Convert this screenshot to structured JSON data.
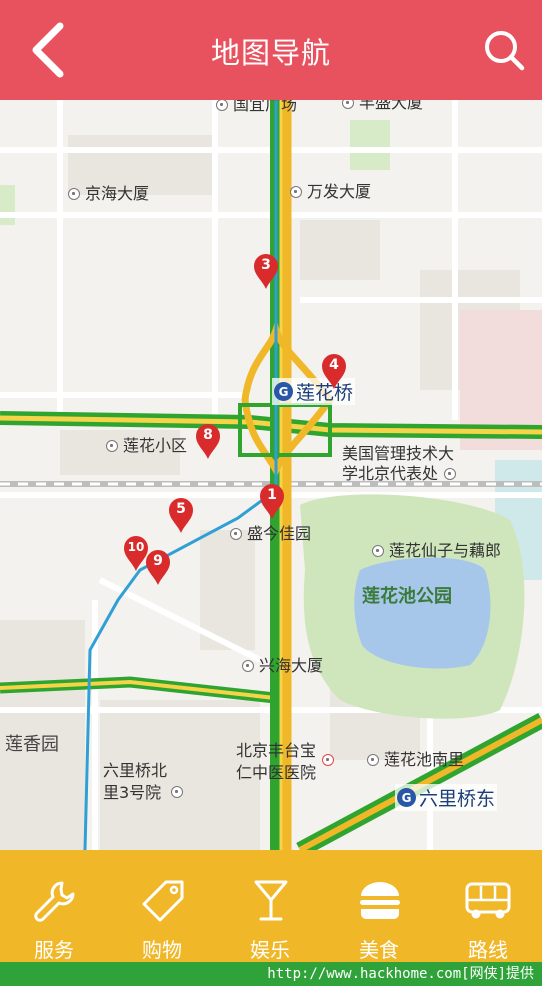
{
  "header": {
    "title": "地图导航"
  },
  "map": {
    "pois": [
      {
        "name": "国宜广场",
        "kind": "building"
      },
      {
        "name": "丰盛大厦",
        "kind": "building"
      },
      {
        "name": "京海大厦",
        "kind": "building"
      },
      {
        "name": "万发大厦",
        "kind": "building"
      },
      {
        "name": "莲花小区",
        "kind": "building"
      },
      {
        "name": "盛今佳园",
        "kind": "building"
      },
      {
        "name": "莲花仙子与藕郎",
        "kind": "building"
      },
      {
        "name": "兴海大厦",
        "kind": "building"
      },
      {
        "name": "莲花池南里",
        "kind": "building"
      }
    ],
    "poi_multi": [
      {
        "line1": "美国管理技术大",
        "line2": "学北京代表处"
      },
      {
        "line1": "北京丰台宝",
        "line2": "仁中医医院"
      },
      {
        "line1": "六里桥北",
        "line2": "里3号院"
      }
    ],
    "park": "莲花池公园",
    "area": "莲香园",
    "metro": [
      {
        "name": "莲花桥",
        "icon": "metro-icon"
      },
      {
        "name": "六里桥东",
        "icon": "metro-icon"
      }
    ],
    "markers": [
      "1",
      "3",
      "4",
      "5",
      "8",
      "9",
      "10"
    ]
  },
  "tabs": [
    {
      "label": "服务",
      "icon": "wrench-icon"
    },
    {
      "label": "购物",
      "icon": "tag-icon"
    },
    {
      "label": "娱乐",
      "icon": "cocktail-glass-icon"
    },
    {
      "label": "美食",
      "icon": "burger-icon"
    },
    {
      "label": "路线",
      "icon": "bus-icon"
    }
  ],
  "watermark": "http://www.hackhome.com[网侠]提供",
  "colors": {
    "header": "#e8525f",
    "tabbar": "#f0b728",
    "statusbar": "#2fa33a",
    "marker": "#d92b2b",
    "route": "#2f9fd6"
  }
}
